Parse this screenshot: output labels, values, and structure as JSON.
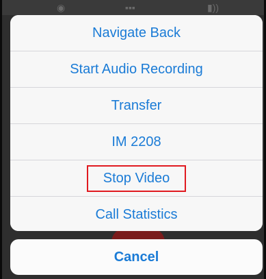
{
  "background": {
    "icons": [
      "microphone-icon",
      "keypad-icon",
      "speaker-icon"
    ]
  },
  "action_sheet": {
    "items": [
      {
        "label": "Navigate Back"
      },
      {
        "label": "Start Audio Recording"
      },
      {
        "label": "Transfer"
      },
      {
        "label": "IM 2208"
      },
      {
        "label": "Stop Video",
        "highlighted": true
      },
      {
        "label": "Call Statistics"
      }
    ],
    "cancel_label": "Cancel"
  },
  "colors": {
    "accent": "#1a7bd6",
    "highlight_box": "#e0191f",
    "end_call": "#7a1b1b"
  }
}
